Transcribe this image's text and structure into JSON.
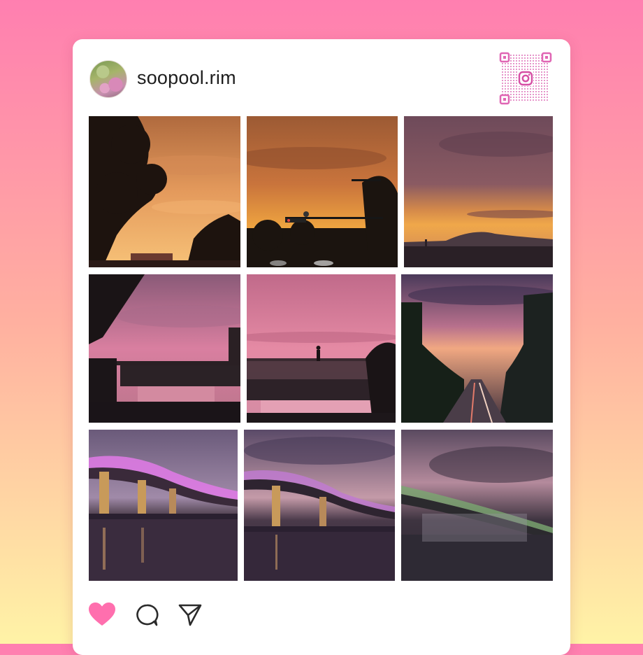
{
  "post": {
    "username": "soopool.rim"
  },
  "icons": {
    "avatar": "avatar",
    "qr": "qr-code-icon",
    "instagram": "instagram-icon",
    "like": "heart-icon",
    "comment": "comment-icon",
    "share": "send-icon"
  },
  "colors": {
    "background_top": "#ff7fb0",
    "background_bottom": "#fff3a6",
    "like_color": "#ff6fae",
    "qr_color": "#e066b4"
  },
  "photos": [
    {
      "name": "sunset-tree",
      "description_label": ""
    },
    {
      "name": "sunset-traffic-light",
      "description_label": ""
    },
    {
      "name": "sunset-mountain",
      "description_label": ""
    },
    {
      "name": "pink-sky-overpass",
      "description_label": ""
    },
    {
      "name": "pink-sky-pedestrian-bridge",
      "description_label": ""
    },
    {
      "name": "dusk-road",
      "description_label": ""
    },
    {
      "name": "bridge-fountain-1",
      "description_label": ""
    },
    {
      "name": "bridge-fountain-2",
      "description_label": ""
    },
    {
      "name": "bridge-fountain-3",
      "description_label": ""
    }
  ]
}
